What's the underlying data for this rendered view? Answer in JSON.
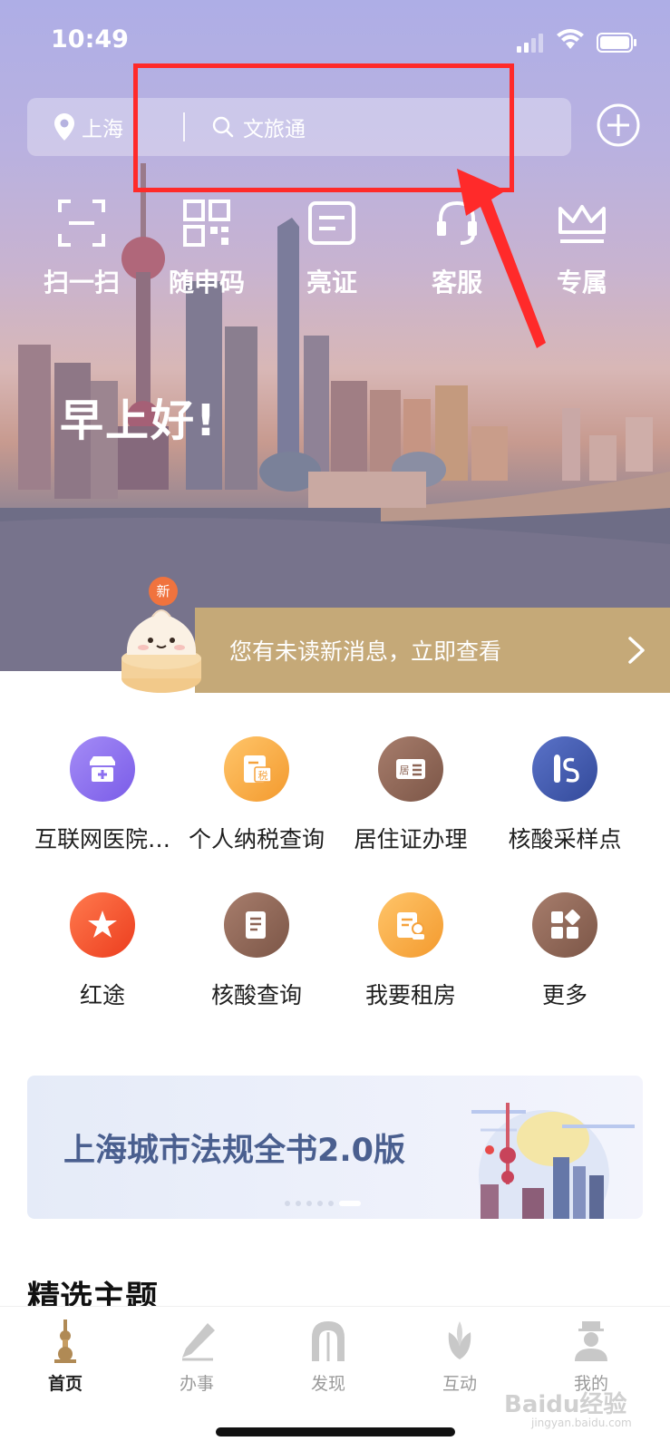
{
  "status_bar": {
    "time": "10:49"
  },
  "header": {
    "location": "上海",
    "search_placeholder": "文旅通"
  },
  "quick_actions": [
    {
      "label": "扫一扫",
      "icon": "scan-icon"
    },
    {
      "label": "随申码",
      "icon": "qr-code-icon"
    },
    {
      "label": "亮证",
      "icon": "id-card-icon"
    },
    {
      "label": "客服",
      "icon": "customer-service-icon"
    },
    {
      "label": "专属",
      "icon": "crown-icon"
    }
  ],
  "greeting": "早上好!",
  "notice": {
    "badge": "新",
    "text": "您有未读新消息，立即查看"
  },
  "services": [
    {
      "label": "互联网医院…",
      "icon": "hospital-store-icon",
      "color": "#8c6ff0"
    },
    {
      "label": "个人纳税查询",
      "icon": "tax-icon",
      "color": "#f5a23c"
    },
    {
      "label": "居住证办理",
      "icon": "residence-card-icon",
      "color": "#8c6455"
    },
    {
      "label": "核酸采样点",
      "icon": "nucleic-test-icon",
      "color": "#3f56a8"
    },
    {
      "label": "红途",
      "icon": "red-star-icon",
      "color": "#f0522a"
    },
    {
      "label": "核酸查询",
      "icon": "document-icon",
      "color": "#8c6455"
    },
    {
      "label": "我要租房",
      "icon": "rent-house-icon",
      "color": "#f5a23c"
    },
    {
      "label": "更多",
      "icon": "more-grid-icon",
      "color": "#8c6455"
    }
  ],
  "banner": {
    "title": "上海城市法规全书2.0版",
    "page_count": 6,
    "active_page": 6
  },
  "section_title": "精选主题",
  "tabs": [
    {
      "label": "首页",
      "icon": "home-tower-icon",
      "active": true
    },
    {
      "label": "办事",
      "icon": "pen-icon",
      "active": false
    },
    {
      "label": "发现",
      "icon": "arch-icon",
      "active": false
    },
    {
      "label": "互动",
      "icon": "magnolia-icon",
      "active": false
    },
    {
      "label": "我的",
      "icon": "profile-icon",
      "active": false
    }
  ],
  "watermark": {
    "text": "Baidu经验",
    "sub": "jingyan.baidu.com"
  },
  "colors": {
    "notice_bg": "#c5a978",
    "annotation": "#ff2a2a",
    "banner_text": "#4a5f8f"
  }
}
